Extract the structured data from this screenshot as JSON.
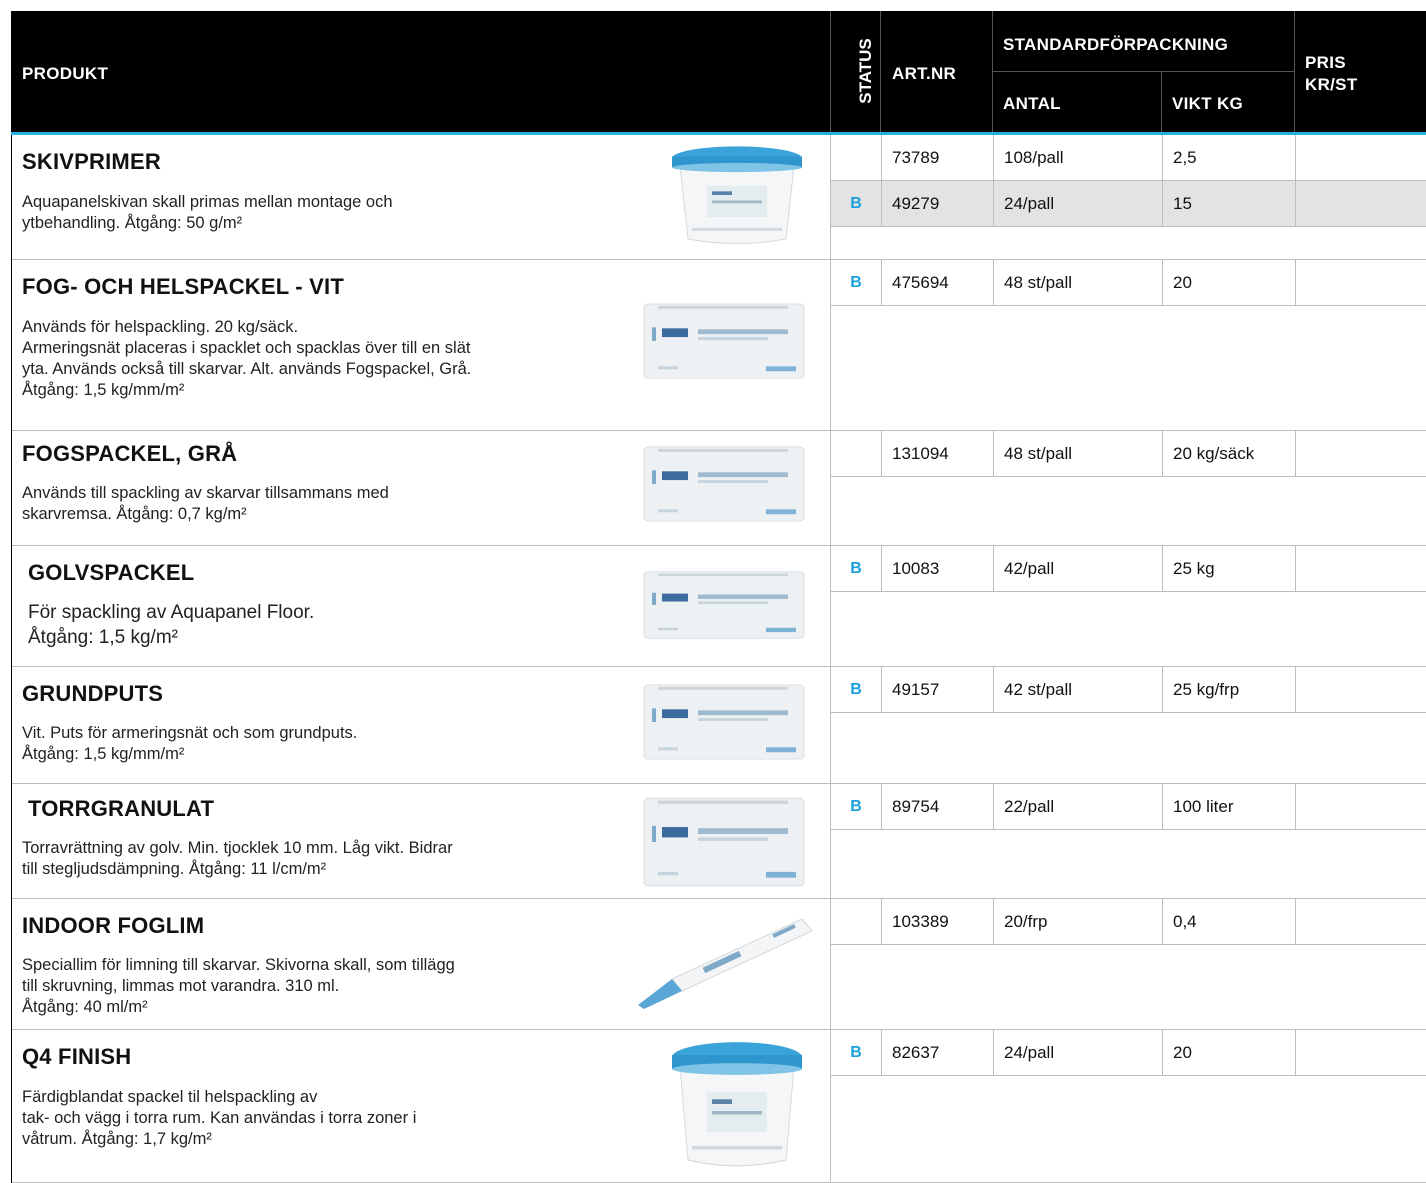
{
  "header": {
    "produkt": "PRODUKT",
    "status": "STATUS",
    "artnr": "ART.NR",
    "standard": "STANDARDFÖRPACKNING",
    "antal": "ANTAL",
    "vikt": "VIKT KG",
    "pris1": "PRIS",
    "pris2": "KR/ST"
  },
  "products": [
    {
      "title": "SKIVPRIMER",
      "desc": [
        "Aquapanelskivan skall primas mellan montage och",
        "ytbehandling. Åtgång: 50 g/m²"
      ],
      "rows": [
        {
          "status": "",
          "artnr": "73789",
          "antal": "108/pall",
          "vikt": "2,5",
          "pris": ""
        },
        {
          "status": "B",
          "artnr": "49279",
          "antal": "24/pall",
          "vikt": "15",
          "pris": ""
        }
      ]
    },
    {
      "title": "FOG- OCH HELSPACKEL - VIT",
      "desc": [
        "Används för helspackling. 20 kg/säck.",
        "Armeringsnät placeras i spacklet och spacklas över till en slät",
        "yta. Används också till skarvar. Alt. används Fogspackel, Grå.",
        "Åtgång: 1,5 kg/mm/m²"
      ],
      "rows": [
        {
          "status": "B",
          "artnr": "475694",
          "antal": "48 st/pall",
          "vikt": "20",
          "pris": ""
        }
      ]
    },
    {
      "title": "FOGSPACKEL, GRÅ",
      "desc": [
        "Används till spackling av skarvar tillsammans med",
        "skarvremsa. Åtgång: 0,7 kg/m²"
      ],
      "rows": [
        {
          "status": "",
          "artnr": "131094",
          "antal": "48 st/pall",
          "vikt": "20 kg/säck",
          "pris": ""
        }
      ]
    },
    {
      "title": "GOLVSPACKEL",
      "desc": [
        "För spackling av Aquapanel Floor.",
        "Åtgång: 1,5 kg/m²"
      ],
      "rows": [
        {
          "status": "B",
          "artnr": "10083",
          "antal": "42/pall",
          "vikt": "25 kg",
          "pris": ""
        }
      ]
    },
    {
      "title": "GRUNDPUTS",
      "desc": [
        "Vit. Puts för armeringsnät och som grundputs.",
        "Åtgång: 1,5 kg/mm/m²"
      ],
      "rows": [
        {
          "status": "B",
          "artnr": "49157",
          "antal": "42 st/pall",
          "vikt": "25 kg/frp",
          "pris": ""
        }
      ]
    },
    {
      "title": "TORRGRANULAT",
      "desc": [
        "Torravrättning av golv. Min. tjocklek 10 mm. Låg vikt. Bidrar",
        "till stegljudsdämpning. Åtgång: 11 l/cm/m²"
      ],
      "rows": [
        {
          "status": "B",
          "artnr": "89754",
          "antal": "22/pall",
          "vikt": "100 liter",
          "pris": ""
        }
      ]
    },
    {
      "title": "INDOOR FOGLIM",
      "desc": [
        "Speciallim för limning till skarvar. Skivorna skall, som tillägg",
        "till skruvning, limmas mot varandra. 310 ml.",
        "Åtgång: 40 ml/m²"
      ],
      "rows": [
        {
          "status": "",
          "artnr": "103389",
          "antal": "20/frp",
          "vikt": "0,4",
          "pris": ""
        }
      ]
    },
    {
      "title": "Q4 FINISH",
      "desc": [
        "Färdigblandat spackel til helspackling av",
        "tak- och vägg i torra rum. Kan användas i torra zoner i",
        "våtrum. Åtgång: 1,7 kg/m²"
      ],
      "rows": [
        {
          "status": "B",
          "artnr": "82637",
          "antal": "24/pall",
          "vikt": "20",
          "pris": ""
        }
      ]
    }
  ],
  "colors": {
    "header_bg": "#000000",
    "accent": "#29aee3",
    "status_b": "#1ba0dc",
    "row_shade": "#e3e3e3"
  },
  "icons": [
    "bucket-image",
    "sack-image",
    "sack-image",
    "sack-image",
    "sack-image",
    "sack-image",
    "tube-image",
    "bucket-image"
  ]
}
